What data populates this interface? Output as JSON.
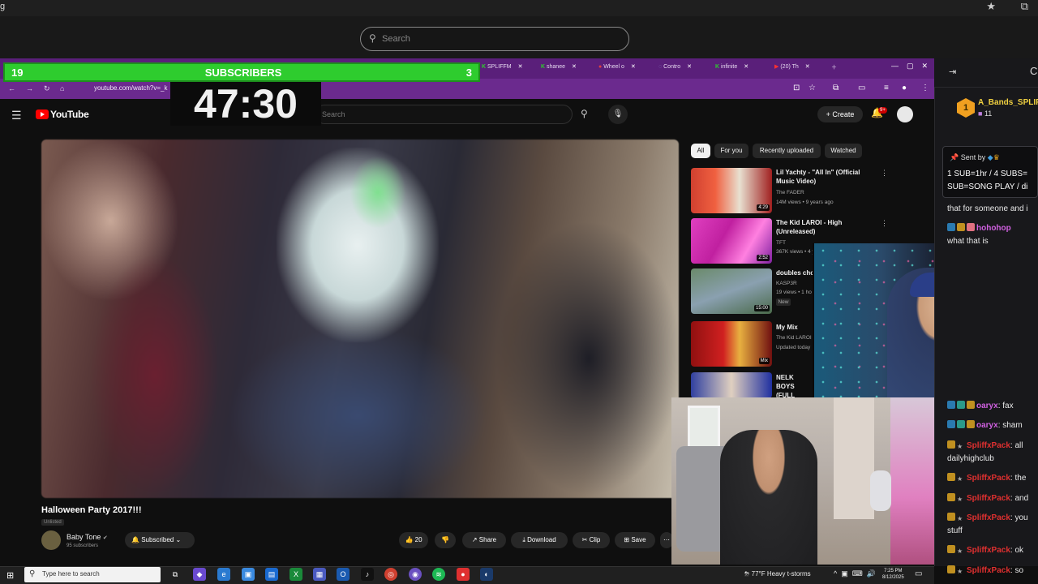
{
  "outer_browser": {
    "left_fragment": "g",
    "search_placeholder": "Search"
  },
  "overlay": {
    "subscribers_left": "19",
    "subscribers_label": "SUBSCRIBERS",
    "subscribers_right": "3",
    "timer": "47:30"
  },
  "inner_browser": {
    "tabs": [
      "SPLIFFM",
      "shanee",
      "Wheel o",
      "Contro",
      "infinite",
      "(20) Th"
    ],
    "url": "youtube.com/watch?v=_k"
  },
  "youtube": {
    "logo_text": "YouTube",
    "search_placeholder": "Search",
    "create_label": "+ Create",
    "notification_count": "9+",
    "chips": [
      "All",
      "For you",
      "Recently uploaded",
      "Watched"
    ],
    "video": {
      "title": "Halloween Party 2017!!!",
      "visibility": "Unlisted",
      "channel": "Baby Tone",
      "channel_subs": "95 subscribers",
      "subscribed_label": "Subscribed",
      "likes": "20",
      "share_label": "Share",
      "download_label": "Download",
      "clip_label": "Clip",
      "save_label": "Save"
    },
    "recommendations": [
      {
        "title": "Lil Yachty - \"All In\" (Official Music Video)",
        "channel": "The FADER",
        "meta": "14M views • 9 years ago",
        "duration": "4:29"
      },
      {
        "title": "The Kid LAROI - High (Unreleased)",
        "channel": "TFT",
        "meta": "367K views • 4 years ago",
        "duration": "2:52"
      },
      {
        "title": "doubles cho",
        "channel": "KASP3R",
        "meta": "19 views • 1 ho",
        "duration": "15:00",
        "badge": "New"
      },
      {
        "title": "My Mix",
        "channel": "The Kid LAROI",
        "meta": "Updated today",
        "duration": "Mix"
      },
      {
        "title": "NELK BOYS (FULL STRE",
        "channel": "",
        "meta": "",
        "duration": ""
      }
    ]
  },
  "chat": {
    "pinned_name": "A_Bands_SPLIF",
    "pinned_count": "11",
    "sent_by": "Sent by",
    "sent_line1": "1 SUB=1hr / 4 SUBS=",
    "sent_line2": "SUB=SONG PLAY / di",
    "messages": [
      {
        "user": "",
        "text": "that for someone and i"
      },
      {
        "user": "hohohop",
        "text": ""
      },
      {
        "user": "",
        "text": "what that is"
      },
      {
        "user": "oaryx",
        "text": ": fax"
      },
      {
        "user": "oaryx",
        "text": ": sham"
      },
      {
        "user": "SpliffxPack",
        "text": ": all"
      },
      {
        "user": "",
        "text": "dailyhighclub"
      },
      {
        "user": "SpliffxPack",
        "text": ": the"
      },
      {
        "user": "SpliffxPack",
        "text": ": and"
      },
      {
        "user": "SpliffxPack",
        "text": ": you"
      },
      {
        "user": "",
        "text": "stuff"
      },
      {
        "user": "SpliffxPack",
        "text": ": ok"
      },
      {
        "user": "SpliffxPack",
        "text": ": so"
      }
    ]
  },
  "taskbar": {
    "search_placeholder": "Type here to search",
    "weather": "77°F  Heavy t-storms",
    "time": "7:25 PM",
    "date": "8/12/2025"
  },
  "colors": {
    "sub_bar": "#2ecc2e",
    "inner_browser": "#6b2a8e",
    "chat_user": "#e03030",
    "chat_user_alt": "#f0d040"
  }
}
